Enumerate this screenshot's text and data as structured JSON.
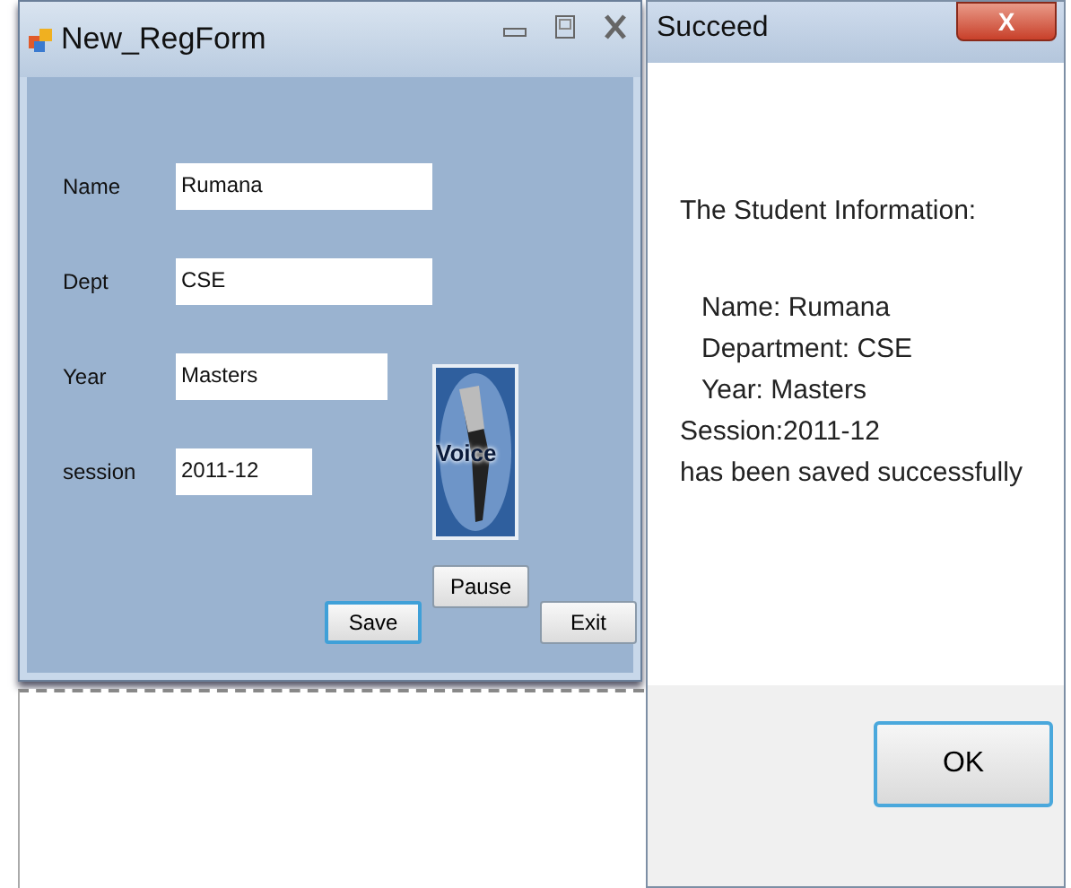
{
  "form_window": {
    "title": "New_RegForm",
    "fields": [
      {
        "label": "Name",
        "value": "Rumana"
      },
      {
        "label": "Dept",
        "value": "CSE"
      },
      {
        "label": "Year",
        "value": "Masters"
      },
      {
        "label": "session",
        "value": "2011-12"
      }
    ],
    "voice_button": "Voice",
    "pause_button": "Pause",
    "save_button": "Save",
    "exit_button": "Exit"
  },
  "dialog": {
    "title": "Succeed",
    "close_button": "X",
    "heading": "The Student Information:",
    "lines": [
      {
        "text": "Name: Rumana",
        "indented": true
      },
      {
        "text": "Department: CSE",
        "indented": true
      },
      {
        "text": "Year: Masters",
        "indented": true
      },
      {
        "text": "Session:2011-12",
        "indented": false
      },
      {
        "text": "has been saved successfully",
        "indented": false
      }
    ],
    "ok_button": "OK"
  }
}
